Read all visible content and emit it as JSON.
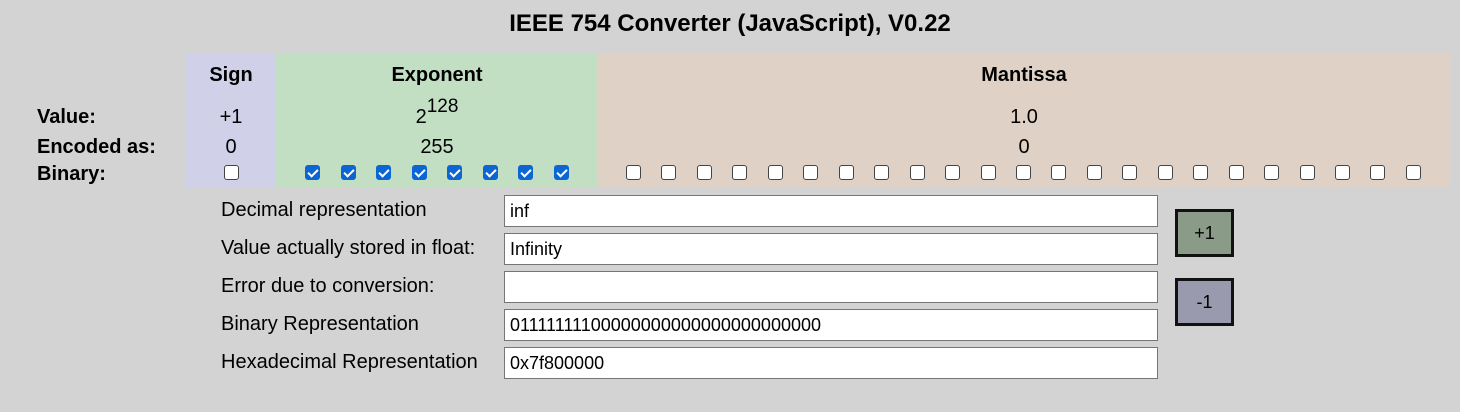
{
  "title": "IEEE 754 Converter (JavaScript), V0.22",
  "columns": {
    "sign": "Sign",
    "exponent": "Exponent",
    "mantissa": "Mantissa"
  },
  "row_labels": {
    "value": "Value:",
    "encoded": "Encoded as:",
    "binary": "Binary:"
  },
  "sign": {
    "value": "+1",
    "encoded": "0",
    "bits": [
      false
    ]
  },
  "exponent": {
    "value_base": "2",
    "value_power": "128",
    "encoded": "255",
    "bits": [
      true,
      true,
      true,
      true,
      true,
      true,
      true,
      true
    ]
  },
  "mantissa": {
    "value": "1.0",
    "encoded": "0",
    "bits": [
      false,
      false,
      false,
      false,
      false,
      false,
      false,
      false,
      false,
      false,
      false,
      false,
      false,
      false,
      false,
      false,
      false,
      false,
      false,
      false,
      false,
      false,
      false
    ]
  },
  "fields": {
    "decimal": {
      "label": "Decimal representation",
      "value": "inf"
    },
    "stored": {
      "label": "Value actually stored in float:",
      "value": "Infinity"
    },
    "error": {
      "label": "Error due to conversion:",
      "value": ""
    },
    "binary": {
      "label": "Binary Representation",
      "value": "01111111100000000000000000000000"
    },
    "hex": {
      "label": "Hexadecimal Representation",
      "value": "0x7f800000"
    }
  },
  "buttons": {
    "increment": "+1",
    "decrement": "-1"
  },
  "colors": {
    "sign_bg": "#d0d0e8",
    "exponent_bg": "#c2dfc4",
    "mantissa_bg": "#dfd1c5",
    "page_bg": "#d3d3d3"
  }
}
